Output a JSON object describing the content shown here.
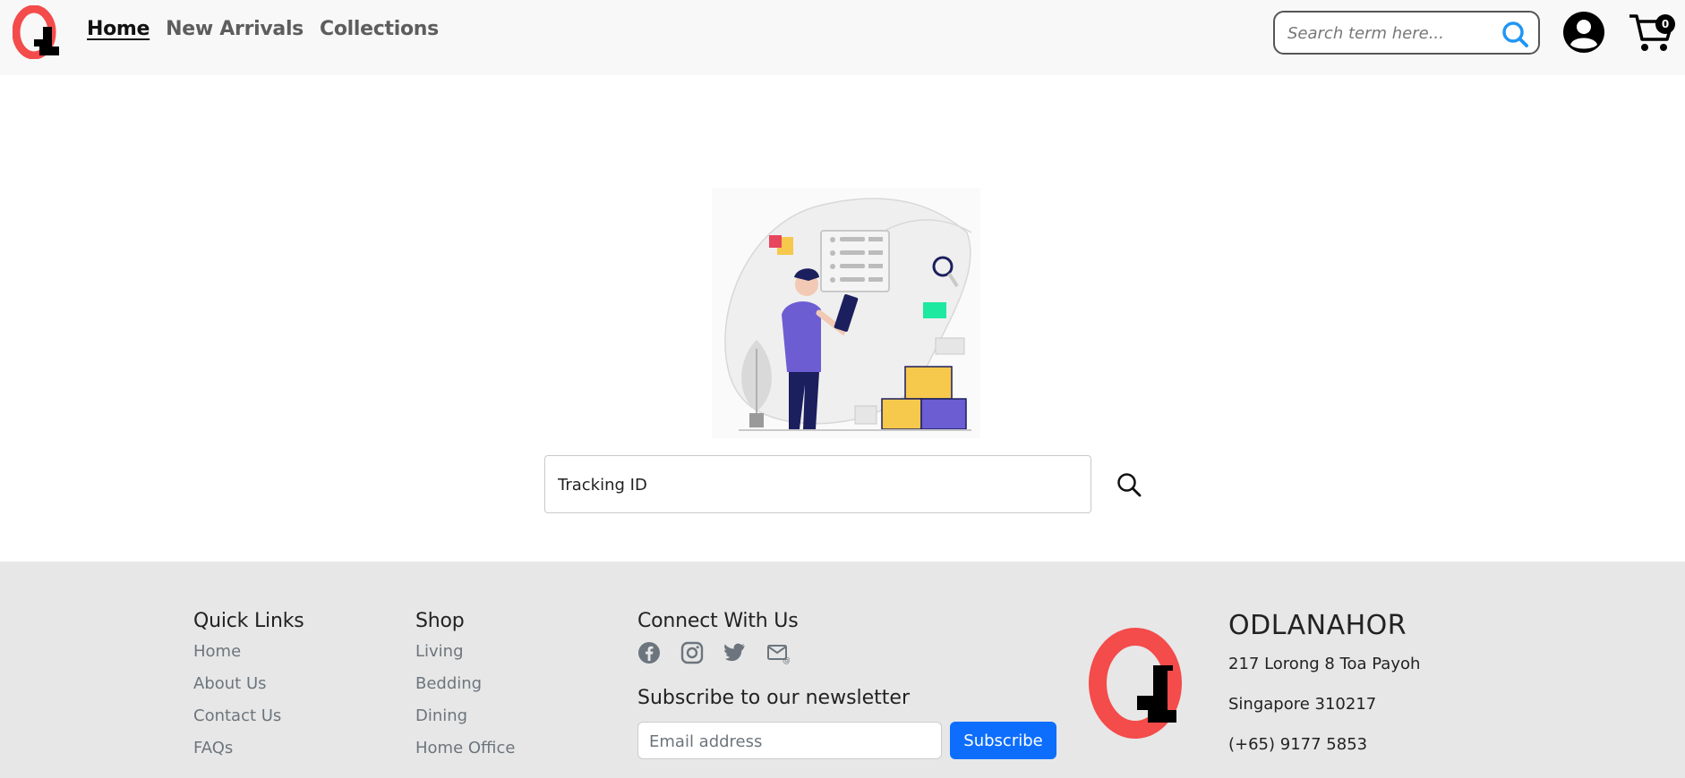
{
  "header": {
    "nav": [
      {
        "label": "Home",
        "active": true
      },
      {
        "label": "New Arrivals",
        "active": false
      },
      {
        "label": "Collections",
        "active": false
      }
    ],
    "search_placeholder": "Search term here...",
    "cart_count": "0"
  },
  "tracking": {
    "placeholder": "Tracking ID"
  },
  "footer": {
    "quick_links": {
      "title": "Quick Links",
      "items": [
        "Home",
        "About Us",
        "Contact Us",
        "FAQs"
      ]
    },
    "shop": {
      "title": "Shop",
      "items": [
        "Living",
        "Bedding",
        "Dining",
        "Home Office"
      ]
    },
    "connect": {
      "title": "Connect With Us",
      "icons": [
        "facebook-icon",
        "instagram-icon",
        "twitter-icon",
        "email-icon"
      ]
    },
    "newsletter": {
      "title": "Subscribe to our newsletter",
      "email_placeholder": "Email address",
      "button": "Subscribe"
    },
    "company": {
      "name": "ODLANAHOR",
      "address_line1": "217 Lorong 8 Toa Payoh",
      "address_line2": "Singapore 310217",
      "phone": "(+65) 9177 5853"
    }
  },
  "colors": {
    "brand_red": "#f44b4b",
    "primary_blue": "#0d6efd",
    "search_icon_blue": "#2196f3",
    "illustration_purple": "#6c5dd3",
    "illustration_yellow": "#f6c84c",
    "illustration_green": "#1de9a0"
  }
}
